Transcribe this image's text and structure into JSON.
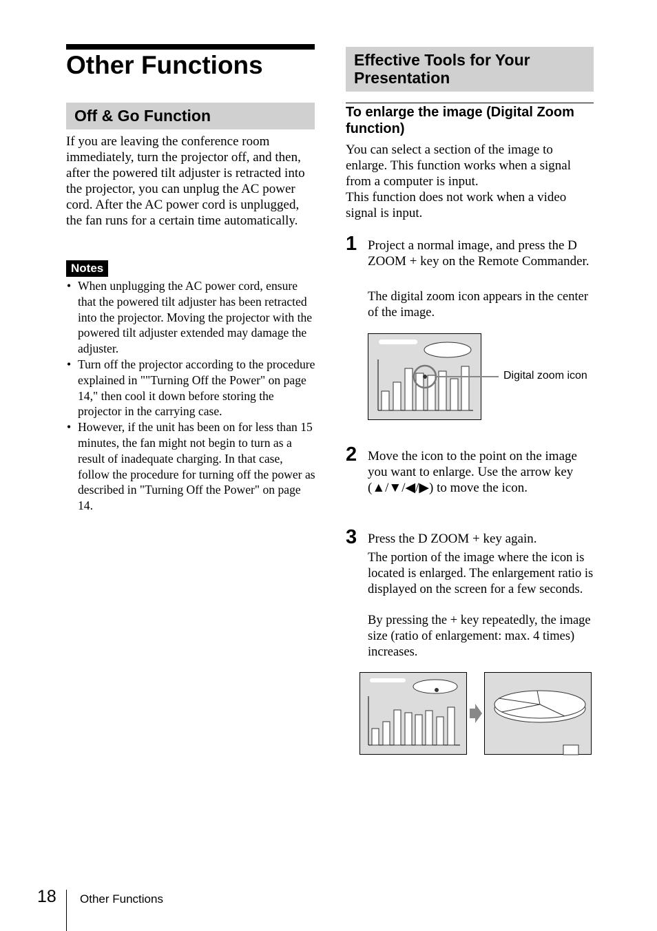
{
  "left": {
    "title": "Other Functions",
    "section": "Off & Go Function",
    "intro": "If you are leaving the conference room immediately, turn the projector off, and then, after the powered tilt adjuster is retracted into the projector, you can unplug the AC power cord. After the AC power cord is unplugged, the fan runs for a certain time automatically.",
    "notes_label": "Notes",
    "notes": [
      "When unplugging the AC power cord, ensure that the powered tilt adjuster has been retracted into the projector. Moving the projector with the powered tilt adjuster extended may damage the adjuster.",
      "Turn off the projector according to the procedure explained in \"\"Turning Off the Power\" on page 14,\" then cool it down before storing the projector in the carrying case.",
      "However, if the unit has been on for less than 15 minutes, the fan might not begin to turn as a result of inadequate charging. In that case, follow the procedure for turning off the power as described in \"Turning Off the Power\" on page 14."
    ]
  },
  "right": {
    "section": "Effective Tools for Your Presentation",
    "subheading": "To enlarge the image (Digital Zoom function)",
    "intro1": "You can select a section of the image to enlarge. This function works when a signal from a computer is input.",
    "intro2": "This function does not work when a video signal is input.",
    "steps": [
      {
        "num": "1",
        "text": "Project a normal image, and press the D ZOOM + key on the Remote Commander.",
        "detail": "The digital zoom icon appears in the center of the image."
      },
      {
        "num": "2",
        "text": "Move the icon to the point on the image you want to enlarge. Use the arrow key (▲/▼/◀/▶) to move the icon."
      },
      {
        "num": "3",
        "text": "Press the D ZOOM + key again.",
        "detail": "The portion of the image where the icon is located is enlarged. The enlargement ratio is displayed on the screen for a few seconds.",
        "detail2": "By pressing the + key repeatedly, the image size (ratio of enlargement: max. 4 times) increases."
      }
    ],
    "callout": "Digital zoom icon"
  },
  "footer": {
    "page": "18",
    "section": "Other Functions"
  }
}
